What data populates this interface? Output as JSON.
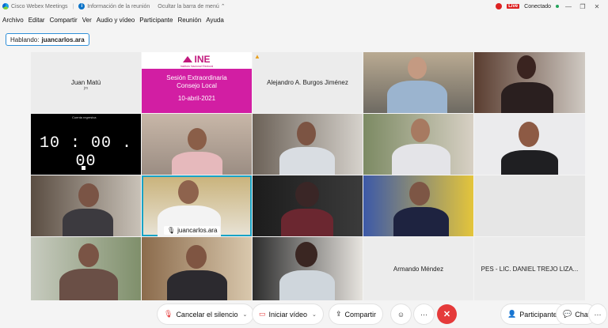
{
  "titlebar": {
    "app_name": "Cisco Webex Meetings",
    "info": "Información de la reunión",
    "hide_menu": "Ocultar la barra de menú",
    "live": "Live",
    "status": "Conectado"
  },
  "menu": [
    "Archivo",
    "Editar",
    "Compartir",
    "Ver",
    "Audio y vídeo",
    "Participante",
    "Reunión",
    "Ayuda"
  ],
  "speaking": {
    "label": "Hablando:",
    "name": "juancarlos.ara"
  },
  "slide": {
    "logo": "INE",
    "logo_sub": "Instituto Nacional Electoral",
    "line1": "Sesión Extraordinaria",
    "line2": "Consejo Local",
    "date": "10-abril-2021"
  },
  "timer": {
    "title": "Cuenta regresiva",
    "digits": "10 : 00 . 00"
  },
  "participants": {
    "juan_matu": "Juan Matú",
    "juan_matu_sub": "jm",
    "alejandro": "Alejandro A. Burgos Jiménez",
    "armando": "Armando Méndez",
    "pes": "PES - LIC. DANIEL TREJO LIZA...",
    "selected_label": "juancarlos.ara"
  },
  "toolbar": {
    "unmute": "Cancelar el silencio",
    "video": "Iniciar vídeo",
    "share": "Compartir",
    "participants": "Participantes",
    "chat": "Chat"
  },
  "colors": {
    "ine_magenta": "#d21ea3",
    "accent_blue": "#2f8fd8",
    "end_red": "#e53a3a",
    "selected_outline": "#18a3c6"
  }
}
